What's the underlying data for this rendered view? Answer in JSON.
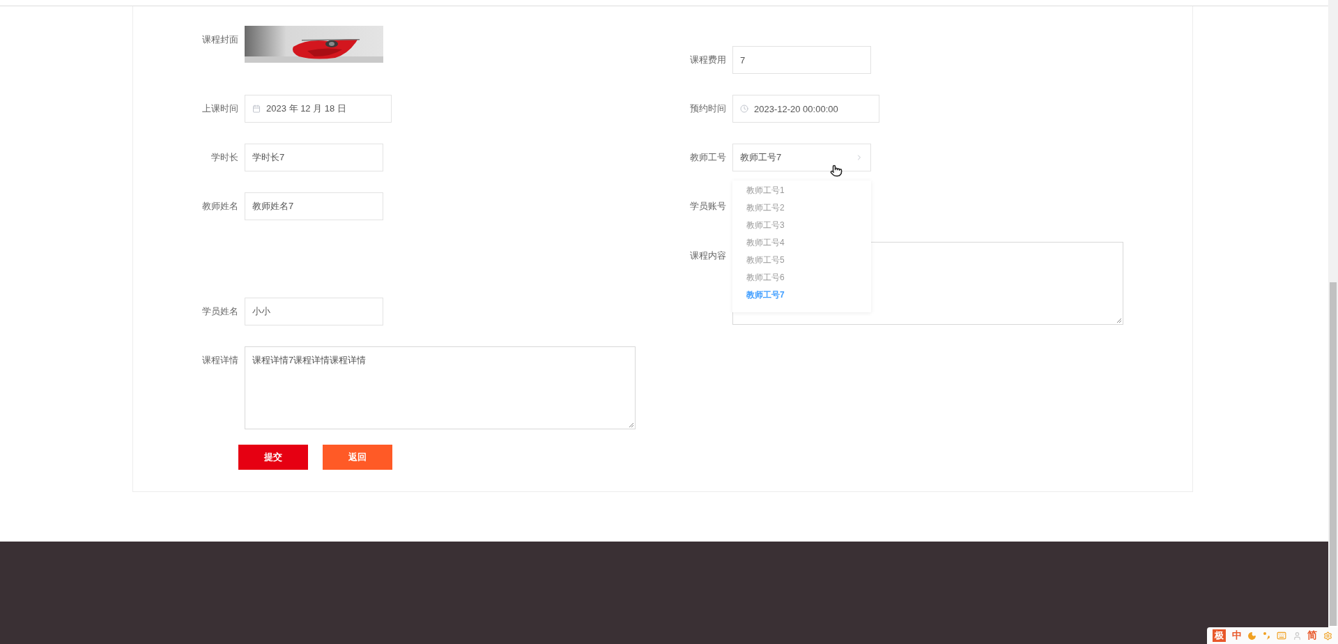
{
  "left_fields": [
    {
      "label": "课程封面"
    },
    {
      "kind": "date",
      "label": "上课时间",
      "value": "2023 年 12 月 18 日"
    },
    {
      "kind": "text",
      "label": "学时长",
      "value": "学时长7"
    },
    {
      "kind": "text",
      "label": "教师姓名",
      "value": "教师姓名7"
    },
    {
      "kind": "text",
      "label": "学员姓名",
      "value": "小小"
    },
    {
      "kind": "textarea",
      "label": "课程详情",
      "value": "课程详情7课程详情课程详情"
    }
  ],
  "right_fields": [
    {
      "kind": "text",
      "label": "课程费用",
      "value": "7"
    },
    {
      "kind": "datetime",
      "label": "预约时间",
      "value": "2023-12-20 00:00:00"
    },
    {
      "kind": "select",
      "label": "教师工号",
      "value": "教师工号7",
      "expanded": true,
      "options": [
        {
          "label": "教师工号1",
          "selected": false
        },
        {
          "label": "教师工号2",
          "selected": false
        },
        {
          "label": "教师工号3",
          "selected": false
        },
        {
          "label": "教师工号4",
          "selected": false
        },
        {
          "label": "教师工号5",
          "selected": false
        },
        {
          "label": "教师工号6",
          "selected": false
        },
        {
          "label": "教师工号7",
          "selected": true
        }
      ]
    },
    {
      "kind": "text",
      "label": "学员账号"
    },
    {
      "kind": "textarea",
      "label": "课程内容"
    }
  ],
  "buttons": [
    {
      "kind": "primary",
      "label": "提交"
    },
    {
      "kind": "secondary",
      "label": "返回"
    }
  ],
  "ime_toolbar": [
    {
      "kind": "badge",
      "text": "极"
    },
    {
      "kind": "text",
      "text": "中"
    },
    {
      "kind": "moon"
    },
    {
      "kind": "punctuation"
    },
    {
      "kind": "keyboard"
    },
    {
      "kind": "user"
    },
    {
      "kind": "text",
      "text": "简"
    },
    {
      "kind": "gear"
    }
  ]
}
